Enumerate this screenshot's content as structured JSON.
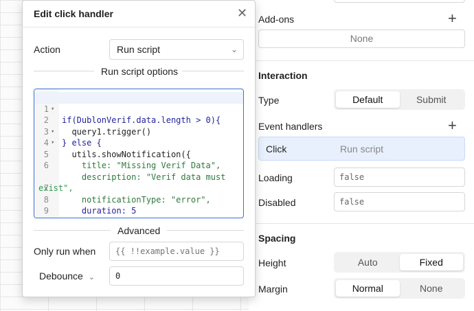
{
  "inspector": {
    "addons_title": "Add-ons",
    "addons_value": "None",
    "interaction_title": "Interaction",
    "type_label": "Type",
    "type_options": [
      "Default",
      "Submit"
    ],
    "event_handlers_title": "Event handlers",
    "handler": {
      "event": "Click",
      "action": "Run script"
    },
    "loading_label": "Loading",
    "loading_value": "false",
    "disabled_label": "Disabled",
    "disabled_value": "false",
    "spacing_title": "Spacing",
    "height_label": "Height",
    "height_options": [
      "Auto",
      "Fixed"
    ],
    "margin_label": "Margin",
    "margin_options": [
      "Normal",
      "None"
    ]
  },
  "modal": {
    "title": "Edit click handler",
    "action_label": "Action",
    "action_value": "Run script",
    "options_heading": "Run script options",
    "advanced_heading": "Advanced",
    "only_run_label": "Only run when",
    "only_run_placeholder": "{{ !!example.value }}",
    "debounce_label": "Debounce",
    "debounce_value": "0"
  },
  "code_lines": [
    "if(DublonVerif.data.length > 0){",
    "  query1.trigger()",
    "} else {",
    "  utils.showNotification({",
    "    title: \"Missing Verif Data\",",
    "    description: \"Verif data must",
    "exist\",",
    "    notificationType: \"error\",",
    "    duration: 5",
    "  })",
    "}"
  ],
  "line_numbers": [
    "1",
    "2",
    "3",
    "4",
    "5",
    "6",
    "",
    "7",
    "8",
    "9",
    "10"
  ],
  "colors": {
    "accent": "#3b6fd6",
    "selected_row": "#e8f0fd"
  }
}
